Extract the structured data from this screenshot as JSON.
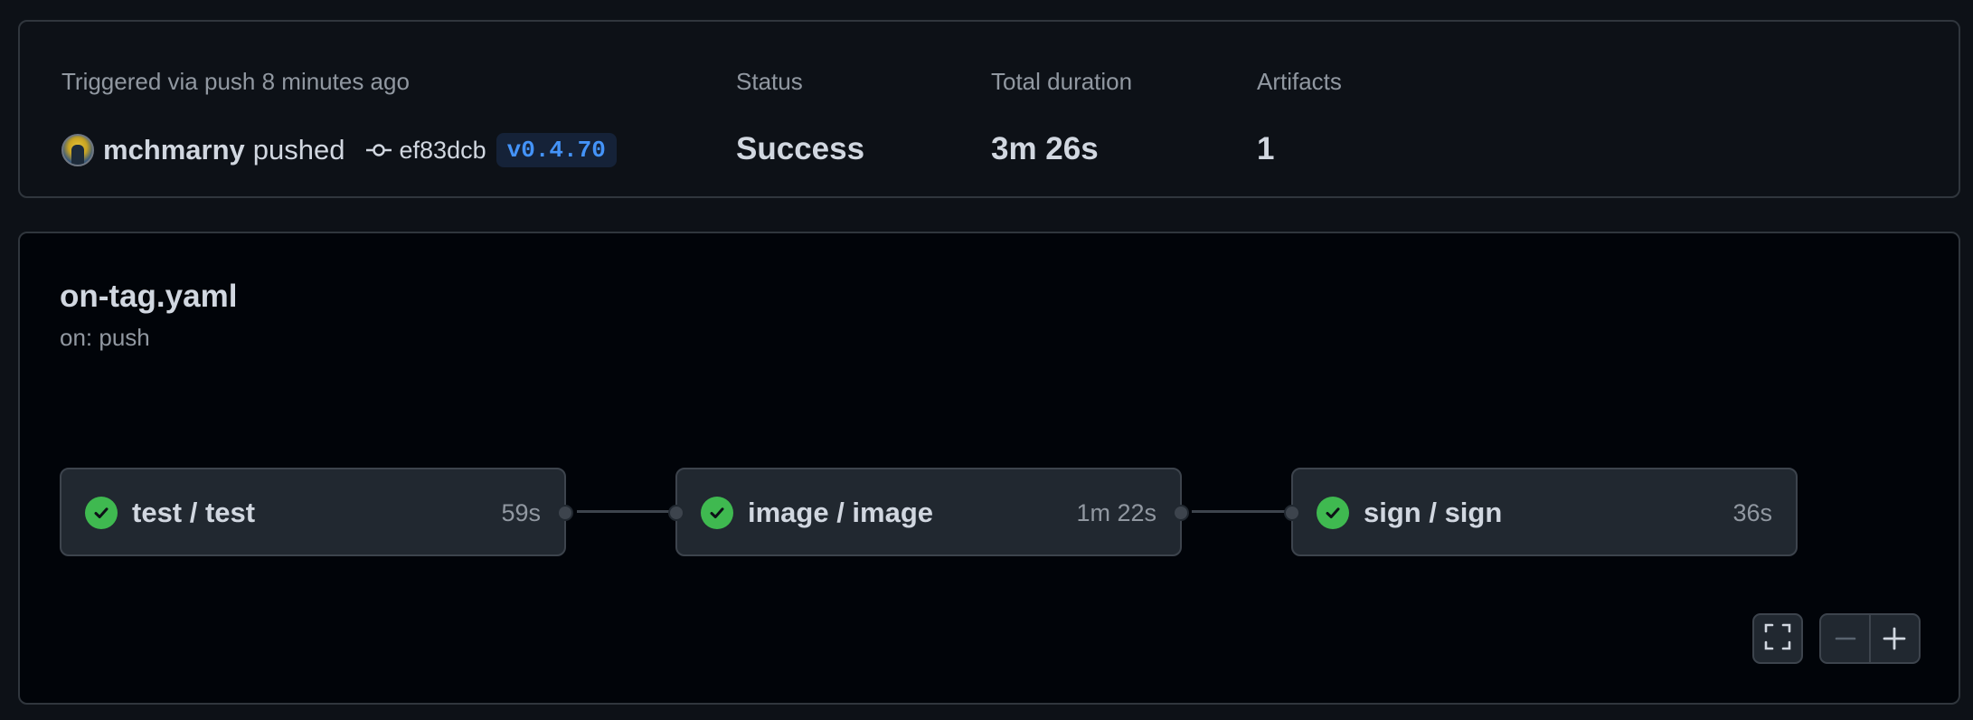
{
  "summary": {
    "trigger_label": "Triggered via push 8 minutes ago",
    "actor": "mchmarny",
    "action": "pushed",
    "commit_sha": "ef83dcb",
    "tag": "v0.4.70",
    "status_label": "Status",
    "status_value": "Success",
    "duration_label": "Total duration",
    "duration_value": "3m 26s",
    "artifacts_label": "Artifacts",
    "artifacts_value": "1"
  },
  "workflow": {
    "file": "on-tag.yaml",
    "trigger": "on: push",
    "jobs": [
      {
        "name": "test / test",
        "duration": "59s",
        "status": "success"
      },
      {
        "name": "image / image",
        "duration": "1m 22s",
        "status": "success"
      },
      {
        "name": "sign / sign",
        "duration": "36s",
        "status": "success"
      }
    ]
  },
  "controls": {
    "fullscreen_icon": "fullscreen-icon",
    "zoom_out_icon": "minus-icon",
    "zoom_in_icon": "plus-icon"
  },
  "colors": {
    "success": "#3fb950",
    "tag_text": "#4493f8",
    "background": "#0d1117"
  }
}
